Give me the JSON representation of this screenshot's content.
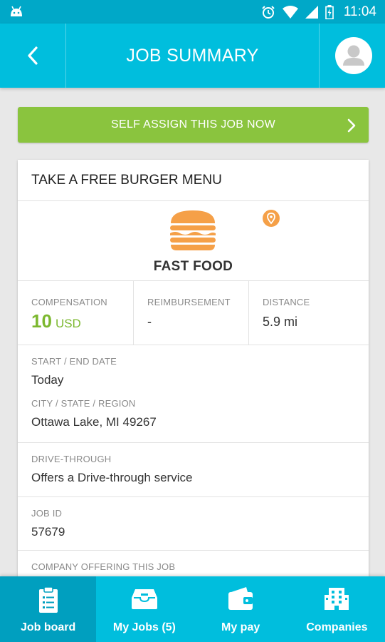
{
  "status_bar": {
    "time": "11:04"
  },
  "header": {
    "title": "JOB SUMMARY"
  },
  "assign_button": {
    "label": "SELF ASSIGN THIS JOB NOW"
  },
  "job": {
    "title": "TAKE A FREE BURGER MENU",
    "category": "FAST FOOD",
    "compensation": {
      "label": "COMPENSATION",
      "amount": "10",
      "currency": "USD"
    },
    "reimbursement": {
      "label": "REIMBURSEMENT",
      "value": "-"
    },
    "distance": {
      "label": "DISTANCE",
      "value": "5.9 mi"
    },
    "start_end_date": {
      "label": "START / END DATE",
      "value": "Today"
    },
    "location": {
      "label": "CITY / STATE / REGION",
      "value": "Ottawa Lake, MI 49267"
    },
    "drive_through": {
      "label": "DRIVE-THROUGH",
      "value": "Offers a Drive-through service"
    },
    "job_id": {
      "label": "JOB ID",
      "value": "57679"
    },
    "company": {
      "label": "COMPANY OFFERING THIS JOB"
    }
  },
  "bottom_nav": {
    "items": [
      {
        "label": "Job board",
        "icon": "clipboard-icon",
        "active": true
      },
      {
        "label": "My Jobs (5)",
        "icon": "inbox-tray-icon",
        "active": false
      },
      {
        "label": "My pay",
        "icon": "wallet-icon",
        "active": false
      },
      {
        "label": "Companies",
        "icon": "building-icon",
        "active": false
      }
    ]
  },
  "colors": {
    "primary": "#00bedd",
    "status_bar": "#00a8c8",
    "accent_green": "#8ac43e",
    "category_orange": "#f5a048",
    "nav_active": "#009fbf"
  }
}
